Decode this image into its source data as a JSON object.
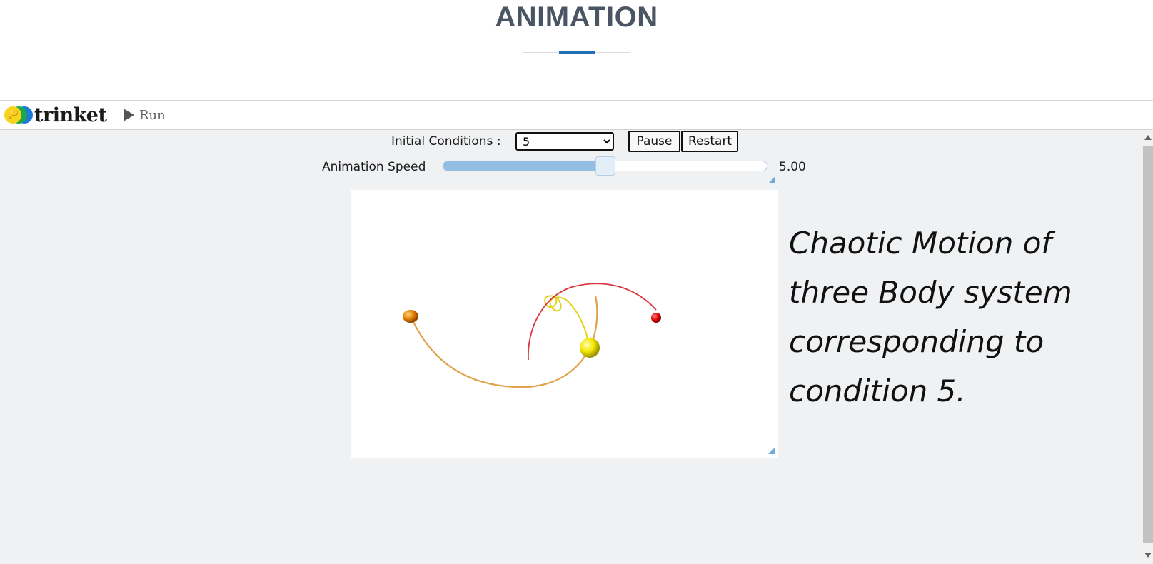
{
  "page": {
    "title": "ANIMATION"
  },
  "toolbar": {
    "logo_text": "trinket",
    "run_label": "Run"
  },
  "controls": {
    "initial_conditions_label": "Initial Conditions :",
    "initial_conditions_selected": "5",
    "pause_label": "Pause",
    "restart_label": "Restart",
    "speed_label": "Animation Speed",
    "speed_value": "5.00",
    "speed_fraction": 0.5
  },
  "caption": "Chaotic Motion of three Body system corresponding to condition 5.",
  "colors": {
    "accent": "#1f6fb2",
    "orbit_red": "#d9363e",
    "orbit_yellow": "#e3d21a",
    "orbit_orange": "#e0a24b",
    "body_red": "#e00000",
    "body_yellow": "#f2e600",
    "body_orange": "#e07b00"
  }
}
